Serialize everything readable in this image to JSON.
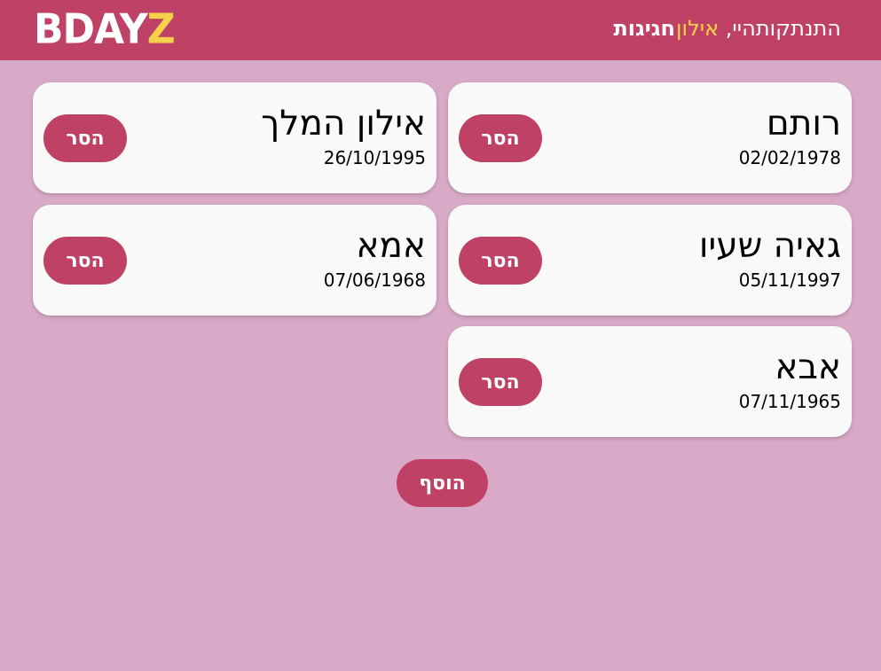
{
  "header": {
    "logo_main": "BDAY",
    "logo_accent": "Z",
    "greeting_prefix": "היי, ",
    "user_name": "אילון",
    "logout_label": "התנתקות",
    "events_label": "חגיגות"
  },
  "cards": [
    {
      "name": "רותם",
      "date": "02/02/1978",
      "remove_label": "הסר"
    },
    {
      "name": "אילון המלך",
      "date": "26/10/1995",
      "remove_label": "הסר"
    },
    {
      "name": "גאיה שעיו",
      "date": "05/11/1997",
      "remove_label": "הסר"
    },
    {
      "name": "אמא",
      "date": "07/06/1968",
      "remove_label": "הסר"
    },
    {
      "name": "אבא",
      "date": "07/11/1965",
      "remove_label": "הסר"
    }
  ],
  "add_label": "הוסף",
  "colors": {
    "brand": "#bf4165",
    "accent": "#f6d24a",
    "background": "#d8aac8",
    "card": "#f9f9f9"
  }
}
